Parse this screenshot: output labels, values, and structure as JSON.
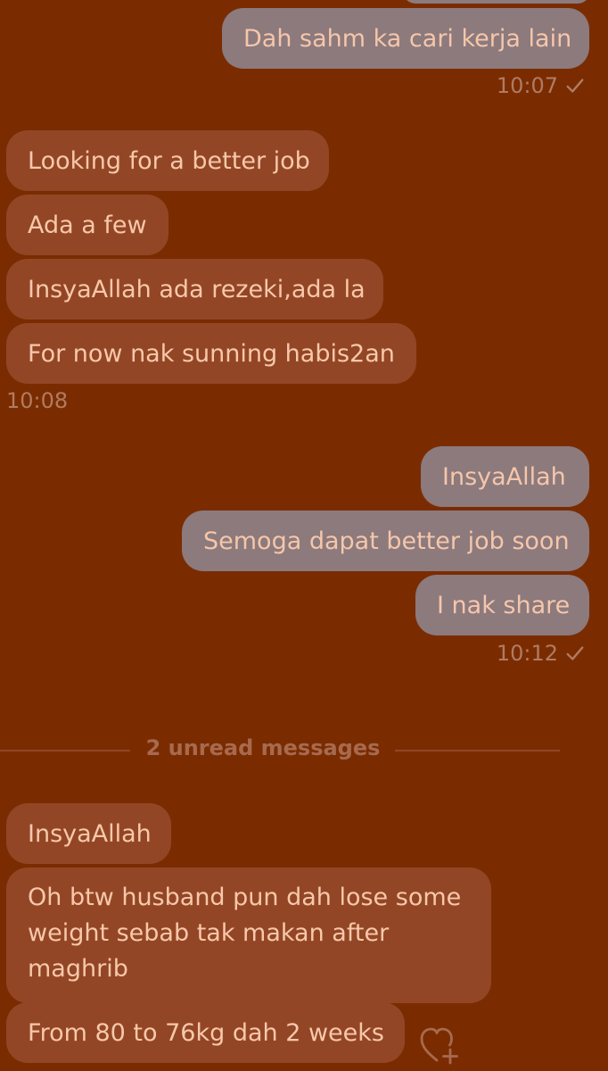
{
  "messages": {
    "m1": "Dah sahm ka cari kerja lain",
    "t1": "10:07",
    "m2": "Looking for a better job",
    "m3": "Ada a few",
    "m4": "InsyaAllah ada rezeki,ada la",
    "m5": "For now nak sunning habis2an",
    "t2": "10:08",
    "m6": "InsyaAllah",
    "m7": "Semoga dapat better job soon",
    "m8": "I nak share",
    "t3": "10:12",
    "unread": "2 unread messages",
    "m9": "InsyaAllah",
    "m10": "Oh btw husband pun dah lose some weight sebab tak makan after maghrib",
    "m11": "From 80 to 76kg dah 2 weeks"
  },
  "colors": {
    "background": "#7a2c00",
    "outgoing_bubble": "#8c7a7d",
    "incoming_bubble": "#934625",
    "text": "#f6c6aa",
    "muted": "#b07b63"
  },
  "icons": {
    "read_receipt": "check-icon",
    "reaction": "heart-plus-icon"
  }
}
